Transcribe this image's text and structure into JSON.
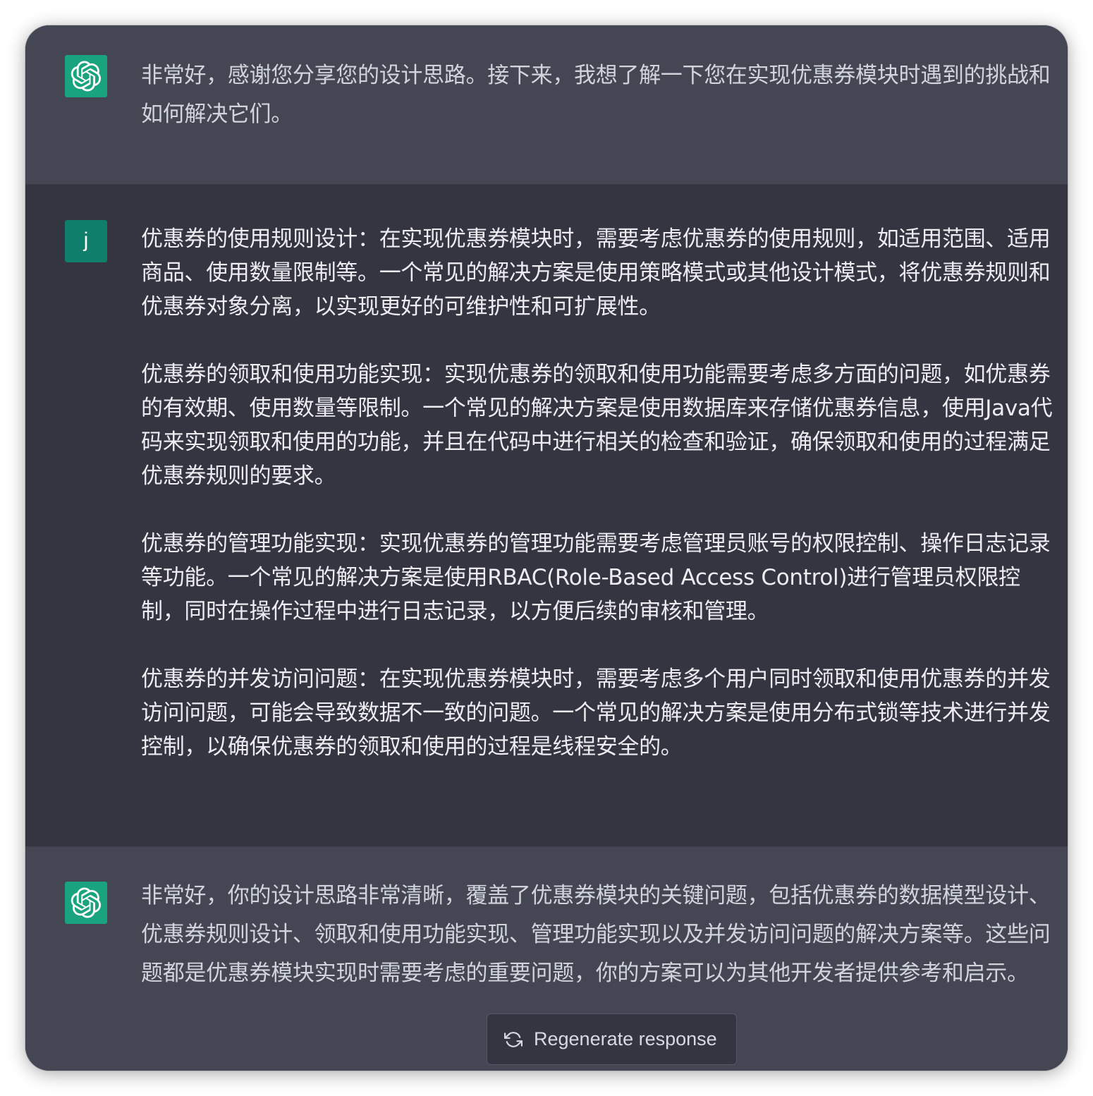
{
  "conversation": {
    "messages": [
      {
        "role": "assistant",
        "avatar_icon": "openai-logo-icon",
        "paragraphs": [
          "非常好，感谢您分享您的设计思路。接下来，我想了解一下您在实现优惠券模块时遇到的挑战和如何解决它们。"
        ]
      },
      {
        "role": "user",
        "avatar_letter": "j",
        "paragraphs": [
          "优惠券的使用规则设计：在实现优惠券模块时，需要考虑优惠券的使用规则，如适用范围、适用商品、使用数量限制等。一个常见的解决方案是使用策略模式或其他设计模式，将优惠券规则和优惠券对象分离，以实现更好的可维护性和可扩展性。",
          "优惠券的领取和使用功能实现：实现优惠券的领取和使用功能需要考虑多方面的问题，如优惠券的有效期、使用数量等限制。一个常见的解决方案是使用数据库来存储优惠券信息，使用Java代码来实现领取和使用的功能，并且在代码中进行相关的检查和验证，确保领取和使用的过程满足优惠券规则的要求。",
          "优惠券的管理功能实现：实现优惠券的管理功能需要考虑管理员账号的权限控制、操作日志记录等功能。一个常见的解决方案是使用RBAC(Role-Based Access Control)进行管理员权限控制，同时在操作过程中进行日志记录，以方便后续的审核和管理。",
          "优惠券的并发访问问题：在实现优惠券模块时，需要考虑多个用户同时领取和使用优惠券的并发访问问题，可能会导致数据不一致的问题。一个常见的解决方案是使用分布式锁等技术进行并发控制，以确保优惠券的领取和使用的过程是线程安全的。"
        ]
      },
      {
        "role": "assistant",
        "avatar_icon": "openai-logo-icon",
        "paragraphs": [
          "非常好，你的设计思路非常清晰，覆盖了优惠券模块的关键问题，包括优惠券的数据模型设计、优惠券规则设计、领取和使用功能实现、管理功能实现以及并发访问问题的解决方案等。这些问题都是优惠券模块实现时需要考虑的重要问题，你的方案可以为其他开发者提供参考和启示。"
        ]
      }
    ]
  },
  "regenerate": {
    "label": "Regenerate response",
    "icon": "refresh-icon"
  },
  "colors": {
    "assistant_bg": "#444654",
    "user_bg": "#343541",
    "bot_avatar": "#19a37f",
    "user_avatar": "#0f7e6b"
  }
}
